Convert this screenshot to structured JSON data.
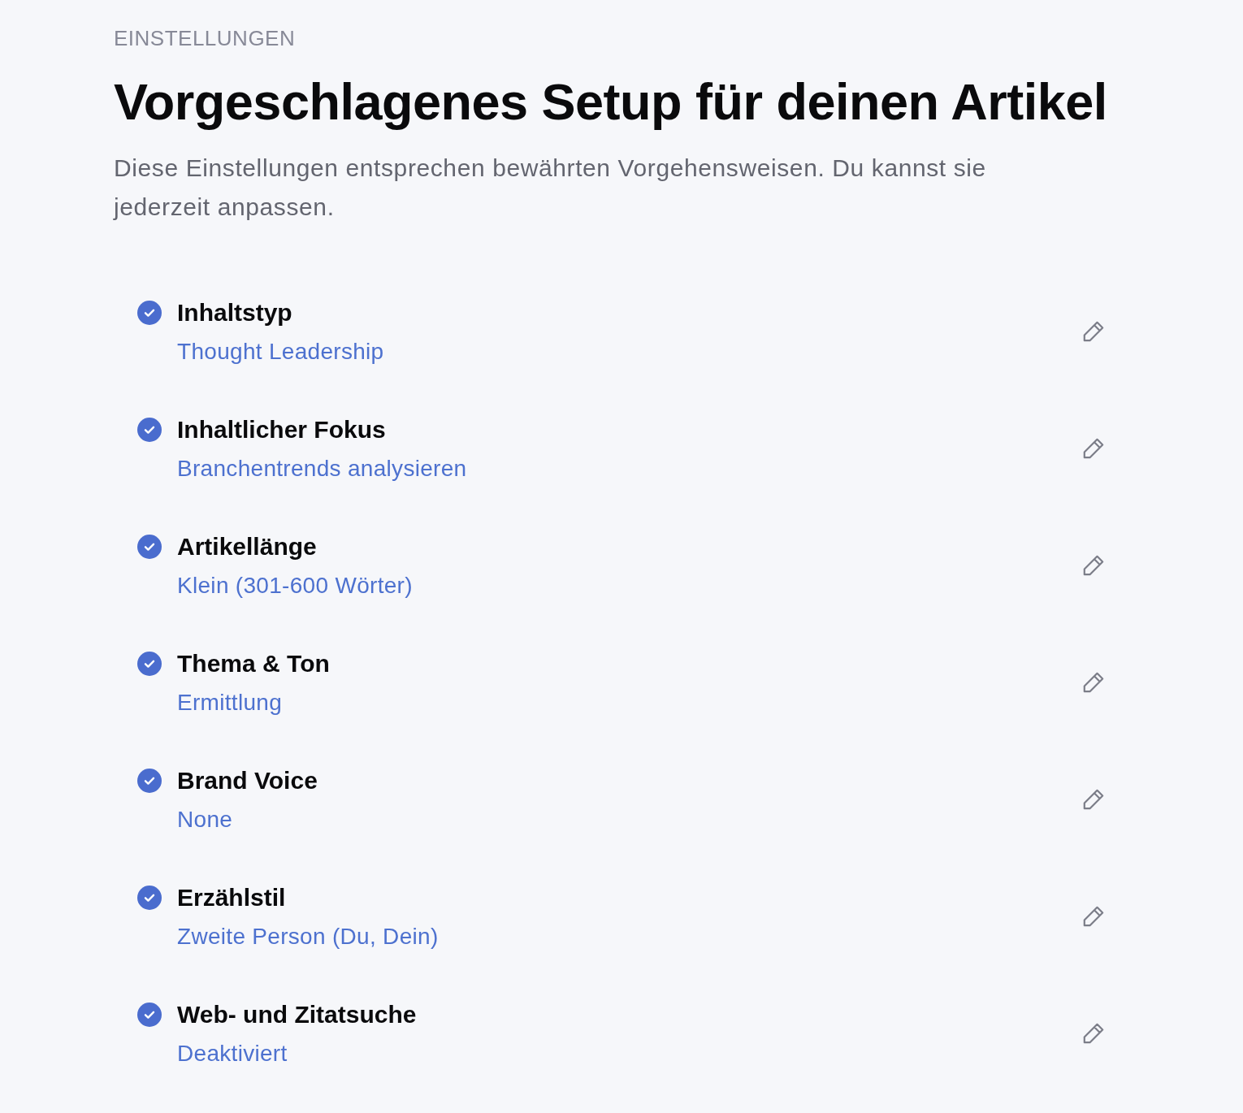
{
  "header": {
    "eyebrow": "EINSTELLUNGEN",
    "title": "Vorgeschlagenes Setup für deinen Artikel",
    "description": "Diese Einstellungen entsprechen bewährten Vorgehensweisen. Du kannst sie jederzeit anpassen."
  },
  "settings": [
    {
      "label": "Inhaltstyp",
      "value": "Thought Leadership",
      "checked": true
    },
    {
      "label": "Inhaltlicher Fokus",
      "value": "Branchentrends analysieren",
      "checked": true
    },
    {
      "label": "Artikellänge",
      "value": "Klein (301-600 Wörter)",
      "checked": true
    },
    {
      "label": "Thema & Ton",
      "value": "Ermittlung",
      "checked": true
    },
    {
      "label": "Brand Voice",
      "value": "None",
      "checked": true
    },
    {
      "label": "Erzählstil",
      "value": "Zweite Person (Du, Dein)",
      "checked": true
    },
    {
      "label": "Web- und Zitatsuche",
      "value": "Deaktiviert",
      "checked": true
    }
  ]
}
